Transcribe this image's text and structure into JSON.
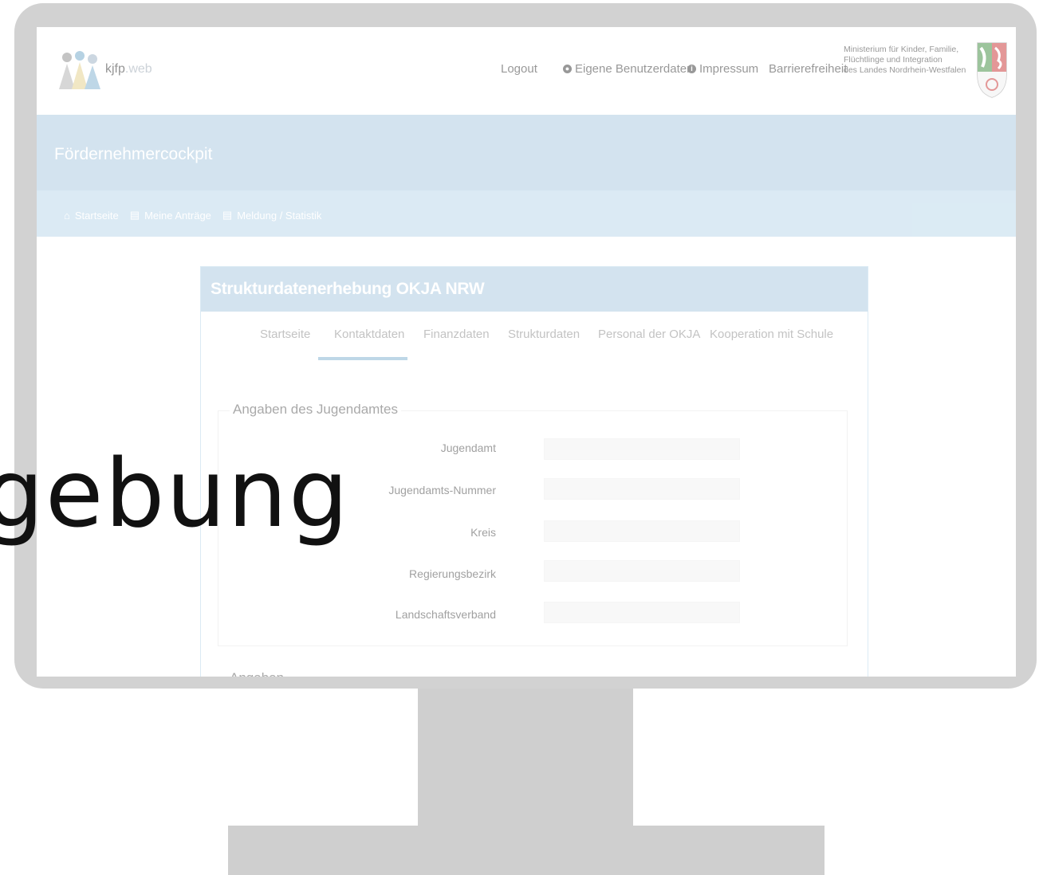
{
  "app": {
    "brand_main": "kjfp",
    "brand_suffix": ".web"
  },
  "top_nav": {
    "logout": "Logout",
    "eigene_benutzerdaten": "Eigene Benutzerdaten",
    "impressum": "Impressum",
    "barrierefreiheit": "Barrierefreiheit"
  },
  "ministry": {
    "line1": "Ministerium für Kinder, Familie,",
    "line2": "Flüchtlinge und Integration",
    "line3": "des Landes Nordrhein-Westfalen"
  },
  "header": {
    "title": "Fördernehmercockpit"
  },
  "sub_nav": [
    {
      "label": "Startseite",
      "icon": "home-icon"
    },
    {
      "label": "Meine Anträge",
      "icon": "document-icon"
    },
    {
      "label": "Meldung / Statistik",
      "icon": "document-icon"
    }
  ],
  "panel": {
    "title": "Strukturdatenerhebung OKJA NRW",
    "tabs": [
      "Startseite",
      "Kontaktdaten",
      "Finanzdaten",
      "Strukturdaten",
      "Personal der OKJA",
      "Kooperation mit Schule"
    ],
    "active_tab": "Kontaktdaten"
  },
  "form": {
    "legend": "Angaben des Jugendamtes",
    "fields": [
      {
        "label": "Jugendamt",
        "value": ""
      },
      {
        "label": "Jugendamts-Nummer",
        "value": ""
      },
      {
        "label": "Kreis",
        "value": ""
      },
      {
        "label": "Regierungsbezirk",
        "value": ""
      },
      {
        "label": "Landschaftsverband",
        "value": ""
      }
    ],
    "next_legend": "Angaben"
  },
  "overlay": {
    "text": "gebung"
  },
  "colors": {
    "bezel": "#d2d2d2",
    "accent_blue": "#a9c9e0",
    "subnav_blue": "#b8d7ea",
    "tab_underline": "#7fb0d1"
  }
}
